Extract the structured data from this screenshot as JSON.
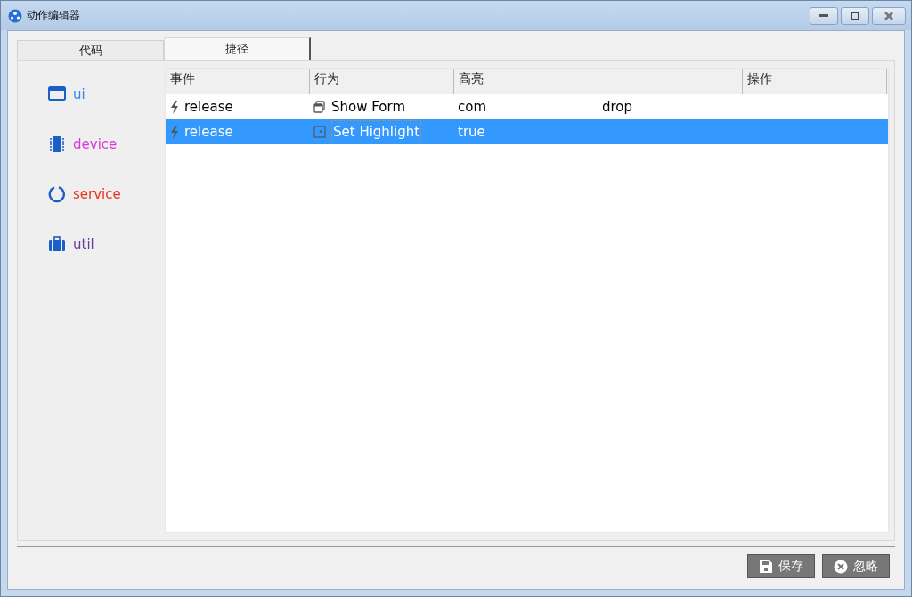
{
  "window": {
    "title": "动作编辑器"
  },
  "tabs": [
    {
      "label": "代码",
      "selected": false
    },
    {
      "label": "捷径",
      "selected": true
    }
  ],
  "sidebar": {
    "items": [
      {
        "label": "ui",
        "color": "#2e8ae6",
        "kind": "window"
      },
      {
        "label": "device",
        "color": "#d63ad6",
        "kind": "chip"
      },
      {
        "label": "service",
        "color": "#e8321e",
        "kind": "ring"
      },
      {
        "label": "util",
        "color": "#6a3a9a",
        "kind": "case"
      }
    ]
  },
  "table": {
    "columns": [
      "事件",
      "行为",
      "高亮",
      "",
      "操作"
    ],
    "rows": [
      {
        "selected": false,
        "event": "release",
        "action": {
          "text": "Show Form",
          "kind": "form"
        },
        "cells": [
          "com",
          "drop",
          ""
        ]
      },
      {
        "selected": true,
        "event": "release",
        "action": {
          "text": "Set Highlight",
          "kind": "highlight"
        },
        "cells": [
          "true",
          "",
          ""
        ]
      }
    ]
  },
  "buttons": [
    {
      "label": "保存",
      "kind": "save"
    },
    {
      "label": "忽略",
      "kind": "ignore"
    }
  ]
}
